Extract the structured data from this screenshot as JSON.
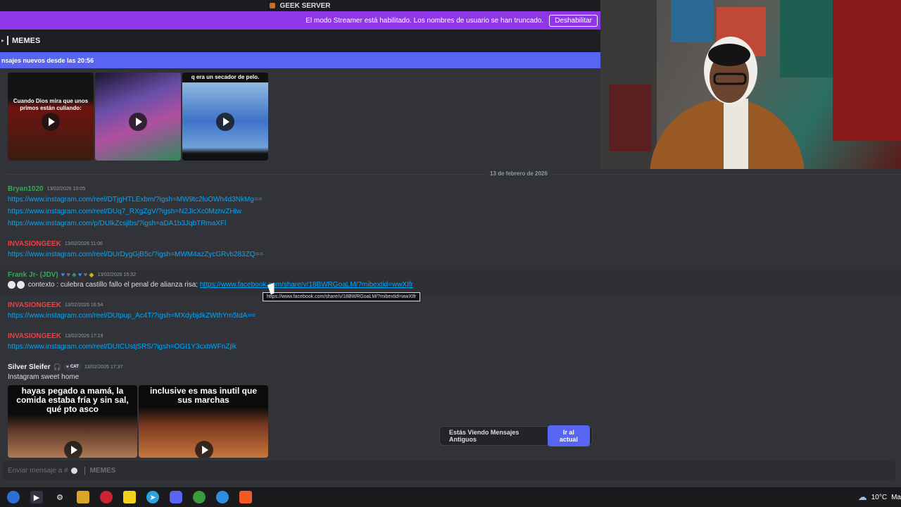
{
  "window": {
    "server_name": "GEEK SERVER"
  },
  "streamer_banner": {
    "text": "El modo Streamer está habilitado. Los nombres de usuario se han truncado.",
    "button": "Deshabilitar"
  },
  "channel": {
    "name": "MEMES"
  },
  "new_messages_bar": {
    "text": "nsajes nuevos desde las 20:56"
  },
  "top_videos": [
    {
      "caption": "Cuando Dios mira que unos primos están culiando:"
    },
    {
      "caption": ""
    },
    {
      "caption": "q era un secador de pelo."
    }
  ],
  "date_divider": "13 de febrero de 2026",
  "messages": [
    {
      "author": "Bryan1020",
      "color": "#3ba55c",
      "time": "13/02/2026 10:05",
      "links": [
        "https://www.instagram.com/reel/DTjgHTLExbm/?igsh=MW9tc2luOWh4d3NkMg==",
        "https://www.instagram.com/reel/DUq7_RXgZgV/?igsh=N2JlcXc0MzhvZHlw",
        "https://www.instagram.com/p/DUlkZcsjlbs/?igsh=aDA1b3JqbTRmaXFl"
      ]
    },
    {
      "author": "INVASIONGEEK",
      "color": "#f23f42",
      "time": "13/02/2026 11:06",
      "links": [
        "https://www.instagram.com/reel/DUrDygGjB5c/?igsh=MWM4azZycGRvb283ZQ=="
      ]
    },
    {
      "author": "Frank Jr- (JDV)",
      "color": "#3ba55c",
      "time": "13/02/2026 15:32",
      "text": "contexto : culebra castillo fallo el penal de alianza risa;",
      "link": "https://www.facebook.com/share/v/18BWRGoaLM/?mibextid=wwXIfr"
    },
    {
      "author": "INVASIONGEEK",
      "color": "#f23f42",
      "time": "13/02/2026 16:54",
      "links": [
        "https://www.instagram.com/reel/DUtpup_Ac4T/?igsh=MXdybjdkZWthYm5tdA=="
      ]
    },
    {
      "author": "INVASIONGEEK",
      "color": "#f23f42",
      "time": "13/02/2026 17:19",
      "links": [
        "https://www.instagram.com/reel/DUtCUstjSRS/?igsh=OGI1Y3cxbWFnZjlk"
      ]
    },
    {
      "author": "Silver Sleifer",
      "color": "#f2f3f5",
      "time": "13/02/2026 17:37",
      "badge": "CAT",
      "text": "Instagram sweet home"
    }
  ],
  "tooltip": "https://www.facebook.com/share/v/18BWRGoaLM/?mibextid=wwXIfr",
  "bottom_videos": [
    {
      "caption": "hayas pegado a mamá, la comida estaba fría y sin sal, qué pto asco"
    },
    {
      "caption": "inclusive es mas inutil que sus marchas"
    }
  ],
  "old_messages_pill": {
    "text": "Estás Viendo Mensajes Antiguos",
    "button": "Ir al actual"
  },
  "composer": {
    "placeholder": "Enviar mensaje a #",
    "channel": "MEMES"
  },
  "taskbar": {
    "weather": "10°C",
    "extra": "Ma"
  }
}
